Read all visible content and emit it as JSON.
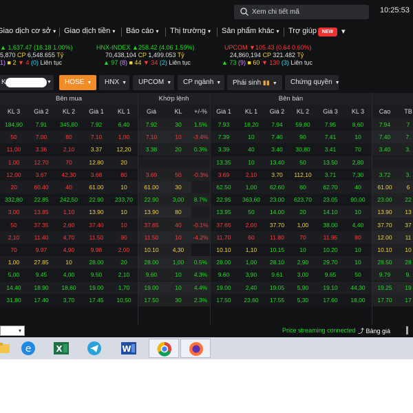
{
  "search": {
    "placeholder": "Xem chi tiết mã"
  },
  "clock": "10:25:53",
  "menu": [
    {
      "label": "Giao dịch cơ sở",
      "caret": "▾"
    },
    {
      "label": "Giao dịch tiền",
      "caret": "▾"
    },
    {
      "label": "Báo cáo",
      "caret": "▾"
    },
    {
      "label": "Thị trường",
      "caret": "▾"
    },
    {
      "label": "Sản phẩm khác",
      "caret": "▾"
    },
    {
      "label": "Trợ giúp",
      "caret": "▾"
    }
  ],
  "menu_badge": "NEW",
  "indices": {
    "left": {
      "line1": "1,637.47 (16.18 1.00%)",
      "line2_vol": "5,870",
      "line2_cp": "CP",
      "line2_val": "6,548.655",
      "line2_unit": "Tỷ",
      "up": "1)",
      "ref": "2",
      "down": "4",
      "down_count": "(0)",
      "session": "Liên tục"
    },
    "hnx": {
      "name": "HNX-INDEX",
      "change": "258.42 (4.06 1.59%)",
      "vol": "70,438,104",
      "cp": "CP",
      "val": "1,499.053",
      "unit": "Tỷ",
      "up": "97",
      "up_c": "(8)",
      "ref": "44",
      "down": "34",
      "down_c": "(2)",
      "session": "Liên tục"
    },
    "upcom": {
      "name": "UPCOM",
      "change": "105.43 (0.64 0.60%)",
      "vol": "24,860,194",
      "cp": "CP",
      "val": "321.482",
      "unit": "Tỷ",
      "up": "73",
      "up_c": "(9)",
      "ref": "60",
      "down": "130",
      "down_c": "(3)",
      "session": "Liên tục"
    }
  },
  "tabs": [
    {
      "label": "K"
    },
    {
      "label": "HOSE"
    },
    {
      "label": "HNX"
    },
    {
      "label": "UPCOM"
    },
    {
      "label": "CP ngành"
    },
    {
      "label": "Phái sinh"
    },
    {
      "label": "Chứng quyền"
    }
  ],
  "groups": {
    "ben_mua": "Bên mua",
    "khop_lenh": "Khớp lệnh",
    "ben_ban": "Bên bán"
  },
  "columns": [
    "KL 3",
    "Giá 2",
    "KL 2",
    "Giá 1",
    "KL 1",
    "Giá",
    "KL",
    "+/-%",
    "Giá 1",
    "KL 1",
    "Giá 2",
    "KL 2",
    "Giá 3",
    "KL 3",
    "Cao",
    "TB"
  ],
  "rows": [
    {
      "cells": [
        "184,90",
        "7.91",
        "345,80",
        "7.92",
        "6,40",
        "7.92",
        "30",
        "1.5%",
        "7.93",
        "18,20",
        "7.94",
        "59,80",
        "7.95",
        "8,60",
        "7.94",
        "7"
      ],
      "colors": [
        "g",
        "g",
        "g",
        "g",
        "g",
        "g",
        "g",
        "g",
        "g",
        "g",
        "g",
        "g",
        "g",
        "g",
        "g",
        "g"
      ]
    },
    {
      "cells": [
        "50",
        "7.00",
        "80",
        "7.10",
        "1,00",
        "7.10",
        "10",
        "-3.4%",
        "7.39",
        "10",
        "7.40",
        "90",
        "7.41",
        "10",
        "7.40",
        "7."
      ],
      "colors": [
        "r",
        "r",
        "r",
        "r",
        "r",
        "r",
        "r",
        "r",
        "g",
        "g",
        "g",
        "g",
        "g",
        "g",
        "g",
        "g"
      ]
    },
    {
      "cells": [
        "11,00",
        "3.36",
        "2,10",
        "3.37",
        "12,20",
        "3.38",
        "20",
        "0.3%",
        "3.39",
        "40",
        "3.40",
        "30,80",
        "3.41",
        "70",
        "3.40",
        "3."
      ],
      "colors": [
        "r",
        "r",
        "r",
        "y",
        "y",
        "g",
        "g",
        "g",
        "g",
        "g",
        "g",
        "g",
        "g",
        "g",
        "g",
        "g"
      ]
    },
    {
      "cells": [
        "1,00",
        "12.70",
        "70",
        "12.80",
        "20",
        "",
        "",
        "",
        "13.35",
        "10",
        "13.40",
        "50",
        "13.50",
        "2,80",
        "",
        ""
      ],
      "colors": [
        "r",
        "r",
        "r",
        "y",
        "y",
        "w",
        "w",
        "w",
        "g",
        "g",
        "g",
        "g",
        "g",
        "g",
        "w",
        "w"
      ]
    },
    {
      "cells": [
        "12,00",
        "3.67",
        "42,30",
        "3.68",
        "80",
        "3.69",
        "50",
        "-0.3%",
        "3.69",
        "2,10",
        "3.70",
        "112,10",
        "3.71",
        "7,30",
        "3.72",
        "3."
      ],
      "colors": [
        "r",
        "r",
        "r",
        "r",
        "r",
        "r",
        "r",
        "r",
        "r",
        "r",
        "y",
        "y",
        "g",
        "g",
        "g",
        "g"
      ]
    },
    {
      "cells": [
        "20",
        "60.40",
        "40",
        "61.00",
        "10",
        "61.00",
        "30",
        "",
        "62.50",
        "1,00",
        "62.60",
        "60",
        "62.70",
        "40",
        "61.00",
        "6"
      ],
      "colors": [
        "r",
        "r",
        "r",
        "y",
        "y",
        "y",
        "y",
        "y",
        "g",
        "g",
        "g",
        "g",
        "g",
        "g",
        "y",
        "y"
      ]
    },
    {
      "cells": [
        "332,80",
        "22.85",
        "242,50",
        "22.90",
        "233,70",
        "22.90",
        "3,00",
        "8.7%",
        "22.95",
        "363,60",
        "23.00",
        "623,70",
        "23.05",
        "90,00",
        "23.00",
        "22"
      ],
      "colors": [
        "g",
        "g",
        "g",
        "g",
        "g",
        "g",
        "g",
        "g",
        "g",
        "g",
        "g",
        "g",
        "g",
        "g",
        "g",
        "g"
      ]
    },
    {
      "cells": [
        "3,00",
        "13.85",
        "1,10",
        "13.90",
        "10",
        "13.90",
        "80",
        "",
        "13.95",
        "50",
        "14.00",
        "20",
        "14.10",
        "10",
        "13.90",
        "13"
      ],
      "colors": [
        "r",
        "r",
        "r",
        "y",
        "y",
        "y",
        "y",
        "y",
        "g",
        "g",
        "g",
        "g",
        "g",
        "g",
        "y",
        "y"
      ]
    },
    {
      "cells": [
        "50",
        "37.35",
        "2,60",
        "37.40",
        "10",
        "37.65",
        "40",
        "-0.1%",
        "37.65",
        "2,00",
        "37.70",
        "1,00",
        "38.00",
        "4,40",
        "37.70",
        "37"
      ],
      "colors": [
        "r",
        "r",
        "r",
        "r",
        "r",
        "r",
        "r",
        "r",
        "r",
        "r",
        "y",
        "y",
        "g",
        "g",
        "y",
        "y"
      ]
    },
    {
      "cells": [
        "2,10",
        "11.40",
        "4,70",
        "11.50",
        "90",
        "11.50",
        "10",
        "-4.2%",
        "11.70",
        "60",
        "11.80",
        "70",
        "11.95",
        "80",
        "12.00",
        "11"
      ],
      "colors": [
        "r",
        "r",
        "r",
        "r",
        "r",
        "r",
        "r",
        "r",
        "r",
        "r",
        "r",
        "r",
        "r",
        "r",
        "y",
        "y"
      ]
    },
    {
      "cells": [
        "70",
        "9.97",
        "4,90",
        "9.98",
        "2,00",
        "10.10",
        "4,30",
        "",
        "10.10",
        "1,10",
        "10.15",
        "10",
        "10.20",
        "10",
        "10.10",
        "10"
      ],
      "colors": [
        "r",
        "r",
        "r",
        "r",
        "r",
        "y",
        "y",
        "y",
        "y",
        "y",
        "g",
        "g",
        "g",
        "g",
        "y",
        "y"
      ]
    },
    {
      "cells": [
        "1,00",
        "27.85",
        "10",
        "28.00",
        "20",
        "28.00",
        "1,00",
        "0.5%",
        "28.00",
        "1,00",
        "28.10",
        "2,90",
        "29.70",
        "10",
        "28.50",
        "28"
      ],
      "colors": [
        "y",
        "y",
        "y",
        "g",
        "g",
        "g",
        "g",
        "g",
        "g",
        "g",
        "g",
        "g",
        "g",
        "g",
        "g",
        "g"
      ]
    },
    {
      "cells": [
        "5,00",
        "9.45",
        "4,00",
        "9.50",
        "2,10",
        "9.60",
        "10",
        "4.3%",
        "9.60",
        "3,90",
        "9.61",
        "3,00",
        "9.65",
        "50",
        "9.79",
        "9."
      ],
      "colors": [
        "g",
        "g",
        "g",
        "g",
        "g",
        "g",
        "g",
        "g",
        "g",
        "g",
        "g",
        "g",
        "g",
        "g",
        "g",
        "g"
      ]
    },
    {
      "cells": [
        "14,40",
        "18.90",
        "18,60",
        "19.00",
        "1,70",
        "19.00",
        "10",
        "4.4%",
        "19.00",
        "2,40",
        "19.05",
        "5,90",
        "19.10",
        "44,30",
        "19.25",
        "19"
      ],
      "colors": [
        "g",
        "g",
        "g",
        "g",
        "g",
        "g",
        "g",
        "g",
        "g",
        "g",
        "g",
        "g",
        "g",
        "g",
        "g",
        "g"
      ]
    },
    {
      "cells": [
        "31,80",
        "17.40",
        "3,70",
        "17.45",
        "10,50",
        "17.50",
        "30",
        "2.3%",
        "17.50",
        "23,60",
        "17.55",
        "5,30",
        "17.60",
        "18,00",
        "17.70",
        "17"
      ],
      "colors": [
        "g",
        "g",
        "g",
        "g",
        "g",
        "g",
        "g",
        "g",
        "g",
        "g",
        "g",
        "g",
        "g",
        "g",
        "g",
        "g"
      ]
    }
  ],
  "status": {
    "connection": "Price streaming connected",
    "price_board": "Bảng giá"
  },
  "taskbar": [
    "file-explorer-icon",
    "edge-icon",
    "excel-icon",
    "telegram-icon",
    "word-icon",
    "chrome-icon",
    "firefox-icon"
  ]
}
